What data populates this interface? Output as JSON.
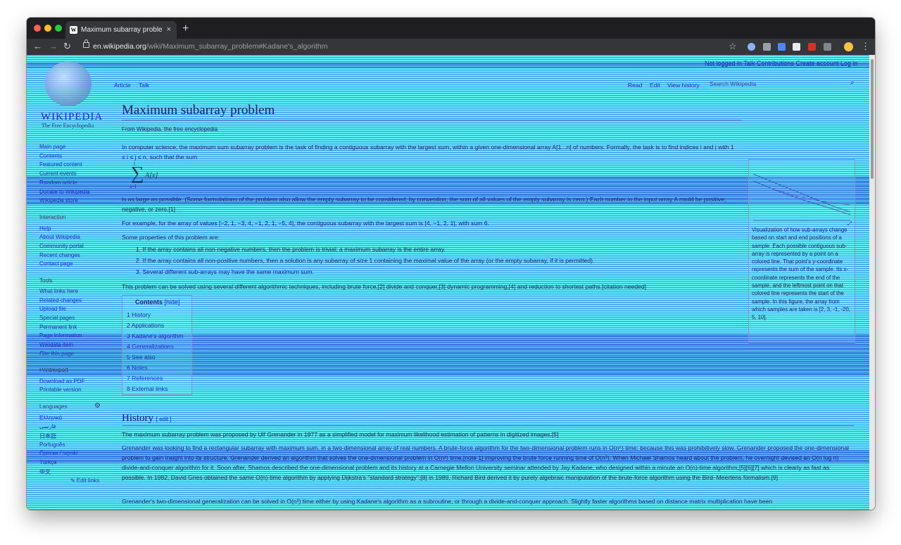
{
  "browser": {
    "tab_title": "Maximum subarray problem - W",
    "tab_close": "×",
    "new_tab": "+",
    "url_host": "en.wikipedia.org",
    "url_path": "/wiki/Maximum_subarray_problem#Kadane's_algorithm"
  },
  "wiki": {
    "wordmark": "WIKIPEDIA",
    "tagline": "The Free Encyclopedia",
    "personal_tools": "Not logged in   Talk   Contributions   Create account   Log in",
    "tabs": {
      "article": "Article",
      "talk": "Talk",
      "read": "Read",
      "edit": "Edit",
      "view_history": "View history",
      "search_placeholder": "Search Wikipedia"
    },
    "sidebar": {
      "nav": [
        "Main page",
        "Contents",
        "Featured content",
        "Current events",
        "Random article",
        "Donate to Wikipedia",
        "Wikipedia store"
      ],
      "interaction_heading": "Interaction",
      "interaction": [
        "Help",
        "About Wikipedia",
        "Community portal",
        "Recent changes",
        "Contact page"
      ],
      "tools_heading": "Tools",
      "tools": [
        "What links here",
        "Related changes",
        "Upload file",
        "Special pages",
        "Permanent link",
        "Page information",
        "Wikidata item",
        "Cite this page"
      ],
      "print_heading": "Print/export",
      "print": [
        "Download as PDF",
        "Printable version"
      ],
      "languages_heading": "Languages",
      "languages": [
        "Ελληνικά",
        "فارسی",
        "日本語",
        "Português",
        "Српски / srpski",
        "Türkçe",
        "中文"
      ],
      "edit_links": "✎ Edit links"
    },
    "title": "Maximum subarray problem",
    "from": "From Wikipedia, the free encyclopedia",
    "intro": "In computer science, the maximum sum subarray problem is the task of finding a contiguous subarray with the largest sum, within a given one-dimensional array A[1...n] of numbers. Formally, the task is to find indices i and j with 1 ≤ i ≤ j ≤ n, such that the sum",
    "formula": {
      "sigma": "∑",
      "sub": "x=i",
      "sup": "j",
      "term": "A[x]"
    },
    "para2": "is as large as possible. (Some formulations of the problem also allow the empty subarray to be considered; by convention, the sum of all values of the empty subarray is zero.) Each number in the input array A could be positive, negative, or zero.[1]",
    "para3": "For example, for the array of values [−2, 1, −3, 4, −1, 2, 1, −5, 4], the contiguous subarray with the largest sum is [4, −1, 2, 1], with sum 6.",
    "para4": "Some properties of this problem are:",
    "properties": [
      "1. If the array contains all non-negative numbers, then the problem is trivial; a maximum subarray is the entire array.",
      "2. If the array contains all non-positive numbers, then a solution is any subarray of size 1 containing the maximal value of the array (or the empty subarray, if it is permitted).",
      "3. Several different sub-arrays may have the same maximum sum."
    ],
    "para5": "This problem can be solved using several different algorithmic techniques, including brute force,[2] divide and conquer,[3] dynamic programming,[4] and reduction to shortest paths.[citation needed]",
    "toc": {
      "title": "Contents",
      "hide": "[hide]",
      "items": [
        "1  History",
        "2  Applications",
        "3  Kadane's algorithm",
        "4  Generalizations",
        "5  See also",
        "6  Notes",
        "7  References",
        "8  External links"
      ]
    },
    "figure_caption": "Visualization of how sub-arrays change based on start and end positions of a sample. Each possible contiguous sub-array is represented by a point on a colored line. That point's y-coordinate represents the sum of the sample. Its x-coordinate represents the end of the sample, and the leftmost point on that colored line represents the start of the sample. In this figure, the array from which samples are taken is [2, 3, -1, -20, 5, 10].",
    "history_heading": "History",
    "history_edit": "[ edit ]",
    "history_p1": "The maximum subarray problem was proposed by Ulf Grenander in 1977 as a simplified model for maximum likelihood estimation of patterns in digitized images.[5]",
    "history_p2": "Grenander was looking to find a rectangular subarray with maximum sum, in a two-dimensional array of real numbers. A brute-force algorithm for the two-dimensional problem runs in O(n⁶) time; because this was prohibitively slow, Grenander proposed the one-dimensional problem to gain insight into its structure. Grenander derived an algorithm that solves the one-dimensional problem in O(n²) time,[note 1] improving the brute force running time of O(n³). When Michael Shamos heard about the problem, he overnight devised an O(n log n) divide-and-conquer algorithm for it. Soon after, Shamos described the one-dimensional problem and its history at a Carnegie Mellon University seminar attended by Jay Kadane, who designed within a minute an O(n)-time algorithm,[5][6][7] which is clearly as fast as possible. In 1982, David Gries obtained the same O(n)-time algorithm by applying Dijkstra's \"standard strategy\";[8] in 1989, Richard Bird derived it by purely algebraic manipulation of the brute-force algorithm using the Bird–Meertens formalism.[9]",
    "history_p3": "Grenander's two-dimensional generalization can be solved in O(n³) time either by using Kadane's algorithm as a subroutine, or through a divide-and-conquer approach. Slightly faster algorithms based on distance matrix multiplication have been"
  }
}
